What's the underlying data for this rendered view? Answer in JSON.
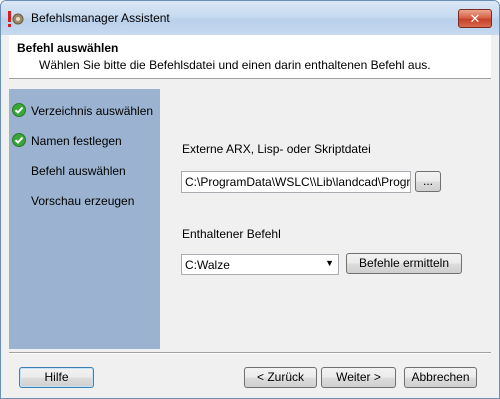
{
  "window": {
    "title": "Befehlsmanager Assistent",
    "close_label": "✕"
  },
  "header": {
    "title": "Befehl auswählen",
    "subtitle": "Wählen Sie bitte die Befehlsdatei und einen darin enthaltenen Befehl aus."
  },
  "steps": [
    {
      "label": "Verzeichnis auswählen",
      "done": true
    },
    {
      "label": "Namen festlegen",
      "done": true
    },
    {
      "label": "Befehl auswählen",
      "done": false
    },
    {
      "label": "Vorschau erzeugen",
      "done": false
    }
  ],
  "form": {
    "file_label": "Externe ARX, Lisp- oder Skriptdatei",
    "file_value": "C:\\ProgramData\\WSLC\\\\Lib\\landcad\\Programm",
    "browse_label": "...",
    "command_label": "Enthaltener Befehl",
    "command_value": "C:Walze",
    "determine_label": "Befehle ermitteln"
  },
  "footer": {
    "help_label": "Hilfe",
    "back_label": "< Zurück",
    "next_label": "Weiter >",
    "cancel_label": "Abbrechen"
  },
  "colors": {
    "steps_panel": "#9bb3d0",
    "check": "#3aa53a"
  }
}
